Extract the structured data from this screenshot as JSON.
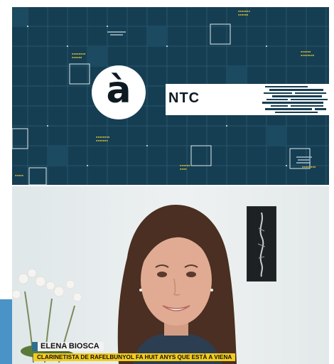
{
  "top_panel": {
    "logo_glyph": "à",
    "program_label": "NTC",
    "colors": {
      "background": "#163e52",
      "grid": "#2c6077",
      "accent": "#f2d03b"
    }
  },
  "bottom_panel": {
    "lower_third": {
      "name": "ELENA BIOSCA",
      "caption": "CLARINETISTA DE RAFELBUNYOL FA HUIT ANYS QUE ESTÀ A VIENA"
    },
    "colors": {
      "name_bg": "#f2f2f2",
      "caption_bg": "#f3cc1f",
      "marker": "#2f6d8f"
    }
  }
}
